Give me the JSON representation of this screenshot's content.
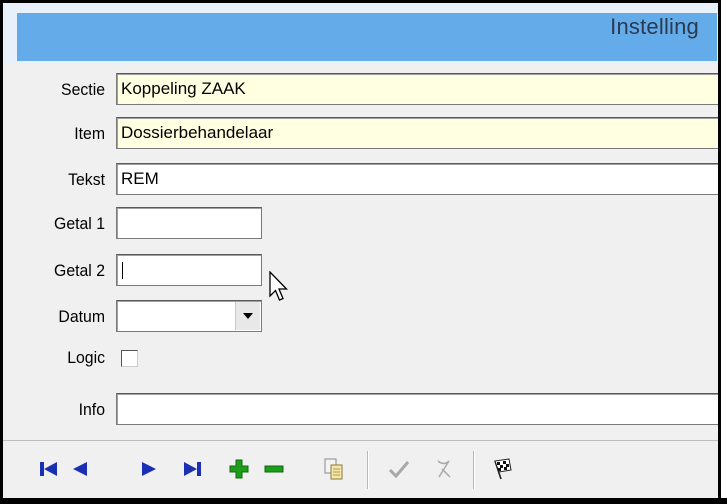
{
  "window": {
    "title": "Instelling"
  },
  "form": {
    "sectie": {
      "label": "Sectie",
      "value": "Koppeling ZAAK"
    },
    "item": {
      "label": "Item",
      "value": "Dossierbehandelaar"
    },
    "tekst": {
      "label": "Tekst",
      "value": "REM"
    },
    "getal1": {
      "label": "Getal 1",
      "value": ""
    },
    "getal2": {
      "label": "Getal 2",
      "value": ""
    },
    "datum": {
      "label": "Datum",
      "value": ""
    },
    "logic": {
      "label": "Logic",
      "checked": false
    },
    "info": {
      "label": "Info",
      "value": ""
    }
  },
  "toolbar": {
    "buttons": [
      {
        "icon": "first-record-icon",
        "enabled": true
      },
      {
        "icon": "previous-record-icon",
        "enabled": true
      },
      {
        "icon": "next-record-icon",
        "enabled": true
      },
      {
        "icon": "last-record-icon",
        "enabled": true
      },
      {
        "icon": "add-record-icon",
        "enabled": true
      },
      {
        "icon": "delete-record-icon",
        "enabled": true
      },
      {
        "icon": "copy-record-icon",
        "enabled": true
      },
      {
        "icon": "confirm-icon",
        "enabled": false
      },
      {
        "icon": "cancel-icon",
        "enabled": false
      },
      {
        "icon": "finish-flag-icon",
        "enabled": true
      }
    ]
  },
  "colors": {
    "title_bar": "#64abea",
    "required_field": "#ffffe1",
    "nav_blue": "#1a2fb4",
    "add_green": "#1c9e1c"
  }
}
